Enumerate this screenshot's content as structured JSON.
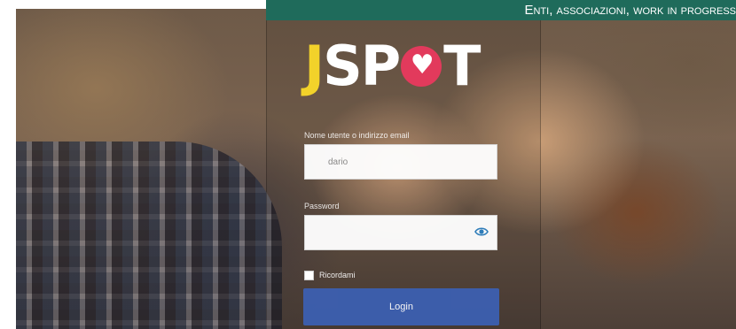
{
  "banner": {
    "text": "Enti, associazioni, work in progress"
  },
  "logo": {
    "part1": "J",
    "part2": "SP",
    "part3": "T"
  },
  "form": {
    "username_label": "Nome utente o indirizzo email",
    "username_value": "dario",
    "password_label": "Password",
    "password_value": "",
    "remember_label": "Ricordami",
    "login_label": "Login"
  },
  "colors": {
    "banner_bg": "#1f6b5b",
    "logo_yellow": "#f2d22a",
    "logo_heart": "#e23a5c",
    "login_button": "#3c5fb1"
  },
  "icons": {
    "password_toggle": "eye-icon",
    "logo_heart": "heart-icon"
  }
}
